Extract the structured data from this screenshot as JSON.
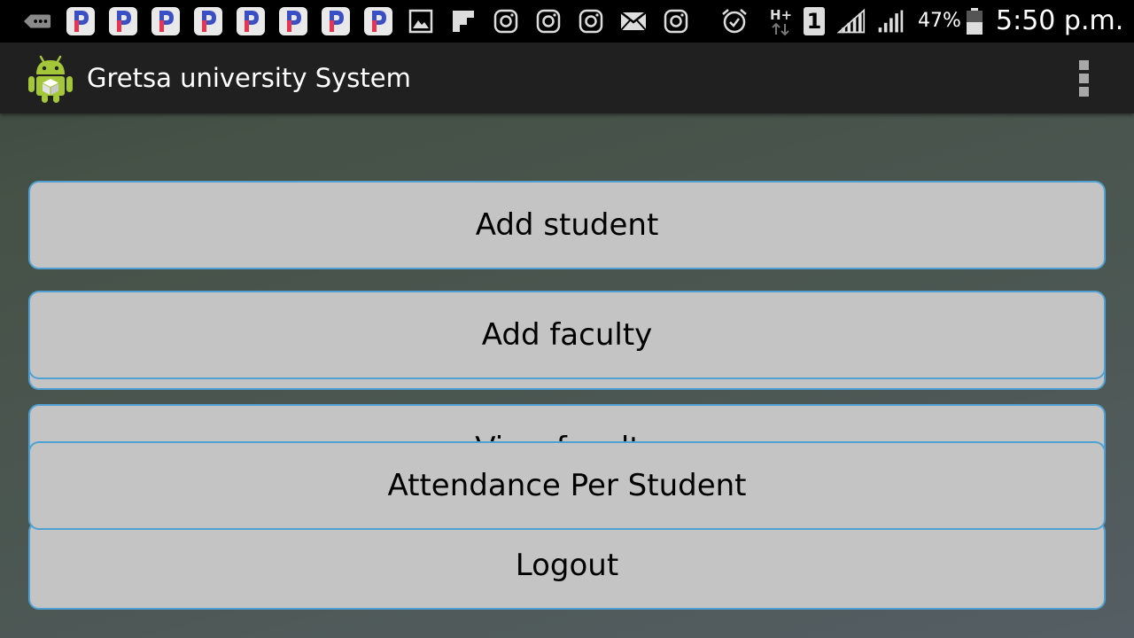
{
  "status_bar": {
    "battery_percent": "47%",
    "time": "5:50 p.m.",
    "network_type": "H+",
    "sim_slot": "1",
    "notification_icons": [
      "pinterest-style-app-icon",
      "gallery-icon",
      "flipboard-icon",
      "instagram-icon",
      "email-icon"
    ],
    "system_icons": [
      "alarm-icon",
      "signal-icon",
      "battery-icon"
    ]
  },
  "app_bar": {
    "title": "Gretsa university System",
    "icon": "android-robot-icon",
    "menu_icon": "overflow-menu-icon"
  },
  "buttons": {
    "add_student": "Add student",
    "add_faculty": "Add faculty",
    "view_faculty": "View faculty",
    "attendance_per_student": "Attendance Per Student",
    "logout": "Logout"
  },
  "colors": {
    "status_bar_bg": "#000000",
    "action_bar_bg": "#202020",
    "button_bg": "#c4c4c4",
    "button_border": "#4fa1d3",
    "notification_p_blue": "#3b4fc4",
    "notification_p_red": "#e8344f"
  }
}
